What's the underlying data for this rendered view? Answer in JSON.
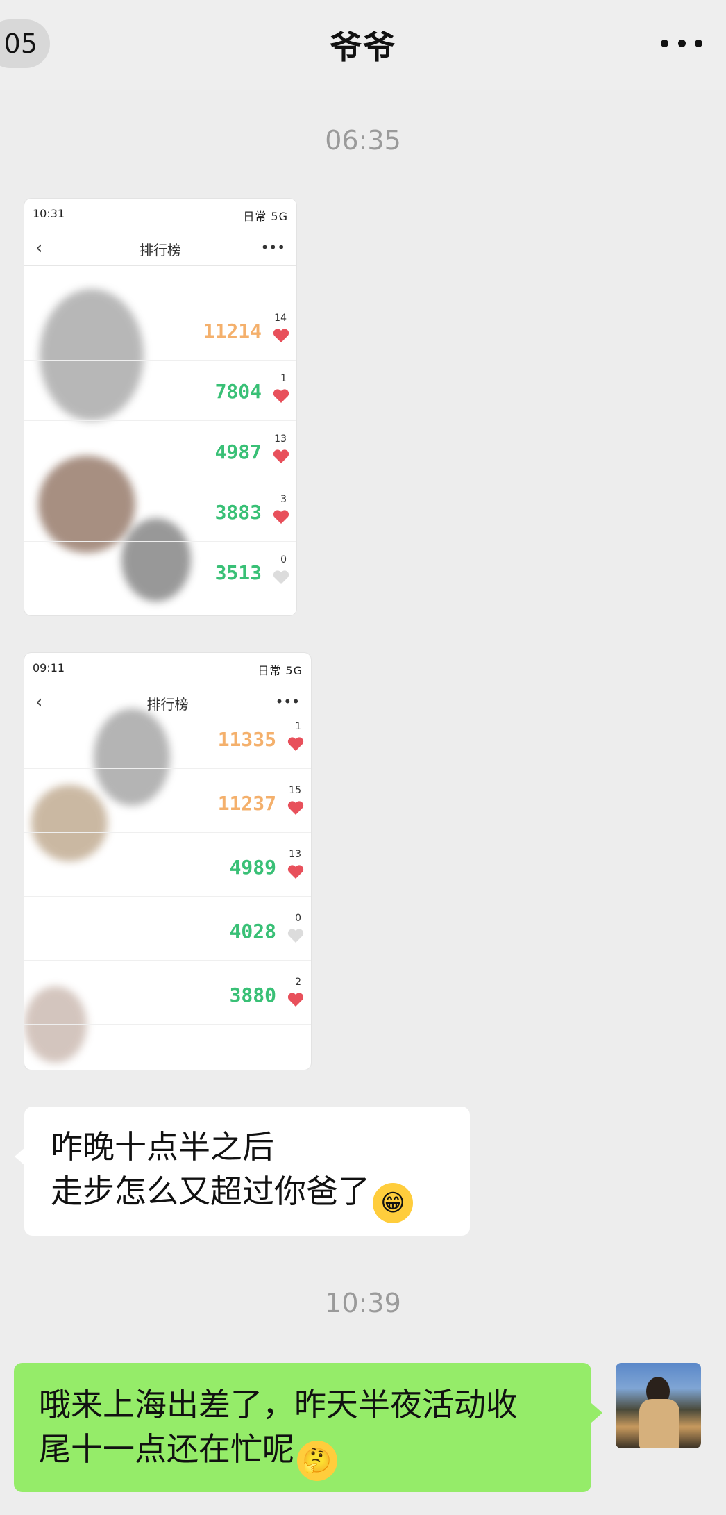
{
  "header": {
    "back_label": "05",
    "title": "爷爷",
    "more_icon": "more-icon"
  },
  "timestamps": [
    "06:35",
    "10:39"
  ],
  "image1": {
    "status_time": "10:31",
    "status_right": "日常 5G",
    "nav_title": "排行榜",
    "rows": [
      {
        "steps": "11214",
        "likes": "14",
        "color": "orange"
      },
      {
        "steps": "7804",
        "likes": "1",
        "color": "green"
      },
      {
        "steps": "4987",
        "likes": "13",
        "color": "green"
      },
      {
        "steps": "3883",
        "likes": "3",
        "color": "green"
      },
      {
        "steps": "3513",
        "likes": "0",
        "color": "green"
      }
    ]
  },
  "image2": {
    "status_time": "09:11",
    "status_right": "日常 5G",
    "nav_title": "排行榜",
    "rows": [
      {
        "steps": "11335",
        "likes": "1",
        "color": "orange"
      },
      {
        "steps": "11237",
        "likes": "15",
        "color": "orange"
      },
      {
        "steps": "4989",
        "likes": "13",
        "color": "green"
      },
      {
        "steps": "4028",
        "likes": "0",
        "color": "green"
      },
      {
        "steps": "3880",
        "likes": "2",
        "color": "green"
      }
    ]
  },
  "messages": {
    "incoming_line1": "咋晚十点半之后",
    "incoming_line2": "走步怎么又超过你爸了",
    "incoming_emoji": "grin-emoji",
    "outgoing_line1": "哦来上海出差了，昨天半夜活动收",
    "outgoing_line2": "尾十一点还在忙呢",
    "outgoing_emoji": "thinking-emoji"
  },
  "colors": {
    "chat_bg": "#ededed",
    "outgoing_bubble": "#95ec69",
    "incoming_bubble": "#ffffff",
    "steps_orange": "#f4b06c",
    "steps_green": "#39c076",
    "heart_red": "#e8505b"
  }
}
